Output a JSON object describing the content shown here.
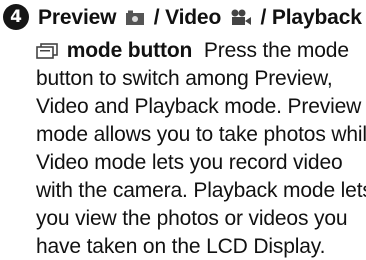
{
  "step": {
    "number": "4",
    "title_part1": "Preview",
    "title_part2": " / Video",
    "title_part3": " / Playback",
    "title_part4": "mode button"
  },
  "body": {
    "line1_tail": "Press the mode",
    "line2": "button to switch among Preview,",
    "line3": "Video and Playback mode. Preview",
    "line4": "mode allows you to take photos while",
    "line5": "Video mode lets you record video",
    "line6": "with the camera. Playback mode lets",
    "line7": "you view the photos or videos you",
    "line8": "have taken on the LCD Display."
  },
  "icons": [
    "camera-icon",
    "video-camera-icon",
    "playback-icon"
  ]
}
